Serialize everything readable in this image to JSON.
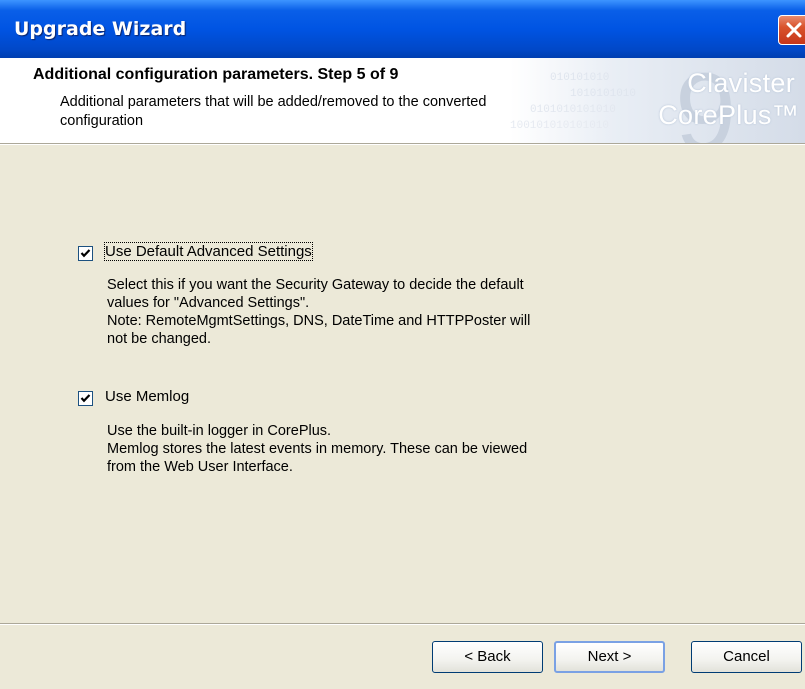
{
  "window": {
    "title": "Upgrade Wizard",
    "close_icon": "close-icon"
  },
  "header": {
    "step_title": "Additional configuration parameters. Step 5 of 9",
    "description": "Additional parameters that will be added/removed to the converted configuration",
    "brand_line1": "Clavister",
    "brand_line2": "CorePlus™",
    "brand_watermark": "9"
  },
  "options": [
    {
      "label": "Use Default Advanced Settings",
      "checked": true,
      "description_lines": [
        "Select this if you want the Security Gateway to decide the default",
        "values for \"Advanced Settings\".",
        "Note: RemoteMgmtSettings, DNS, DateTime and HTTPPoster will",
        "not be changed."
      ]
    },
    {
      "label": "Use Memlog",
      "checked": true,
      "description_lines": [
        "Use the built-in logger in CorePlus.",
        "Memlog stores the latest events in memory. These can be viewed",
        "from the Web User Interface."
      ]
    }
  ],
  "buttons": {
    "back": "< Back",
    "next": "Next >",
    "cancel": "Cancel"
  },
  "colors": {
    "titlebar": "#0054e3",
    "dialog_bg": "#ece9d8",
    "close_button": "#d9532c"
  }
}
